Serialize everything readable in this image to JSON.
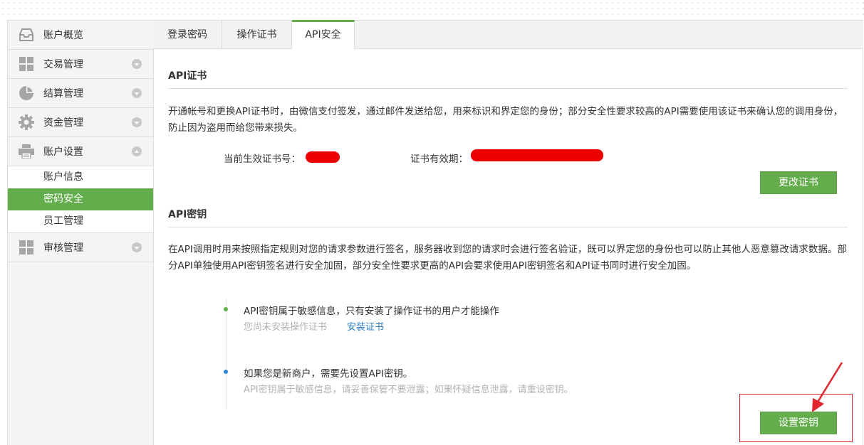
{
  "sidebar": {
    "items": [
      {
        "label": "账户概览",
        "icon": "inbox-icon",
        "toggle": null
      },
      {
        "label": "交易管理",
        "icon": "grid-icon",
        "toggle": "down"
      },
      {
        "label": "结算管理",
        "icon": "pie-chart-icon",
        "toggle": "down"
      },
      {
        "label": "资金管理",
        "icon": "gear-icon",
        "toggle": "down"
      },
      {
        "label": "账户设置",
        "icon": "printer-icon",
        "toggle": "up"
      }
    ],
    "sub_items": [
      "账户信息",
      "密码安全",
      "员工管理"
    ],
    "active_sub": "密码安全",
    "last_item": {
      "label": "审核管理",
      "icon": "grid-icon",
      "toggle": "down"
    }
  },
  "tabs": [
    "登录密码",
    "操作证书",
    "API安全"
  ],
  "active_tab": "API安全",
  "cert_section": {
    "title": "API证书",
    "description": "开通帐号和更换API证书时，由微信支付签发，通过邮件发送给您，用来标识和界定您的身份；部分安全性要求较高的API需要使用该证书来确认您的调用身份，防止因为盗用而给您带来损失。",
    "cert_number_label": "当前生效证书号：",
    "cert_validity_label": "证书有效期：",
    "change_button": "更改证书"
  },
  "key_section": {
    "title": "API密钥",
    "description": "在API调用时用来按照指定规则对您的请求参数进行签名，服务器收到您的请求时会进行签名验证，既可以界定您的身份也可以防止其他人恶意篡改请求数据。部分API单独使用API密钥签名进行安全加固，部分安全性要求更高的API会要求使用API密钥签名和API证书同时进行安全加固。",
    "step1_text": "API密钥属于敏感信息，只有安装了操作证书的用户才能操作",
    "step1_sub": "您尚未安装操作证书",
    "step1_link": "安装证书",
    "step2_text": "如果您是新商户，需要先设置API密钥。",
    "step2_sub": "API密钥属于敏感信息，请妥善保管不要泄露；如果怀疑信息泄露，请重设密钥。",
    "set_button": "设置密钥"
  },
  "colors": {
    "accent_green": "#64ad4c",
    "link_blue": "#2e7cc4",
    "redaction_red": "#ee0000",
    "annotation_red": "#e0262c",
    "dot_blue": "#2f86d0"
  }
}
